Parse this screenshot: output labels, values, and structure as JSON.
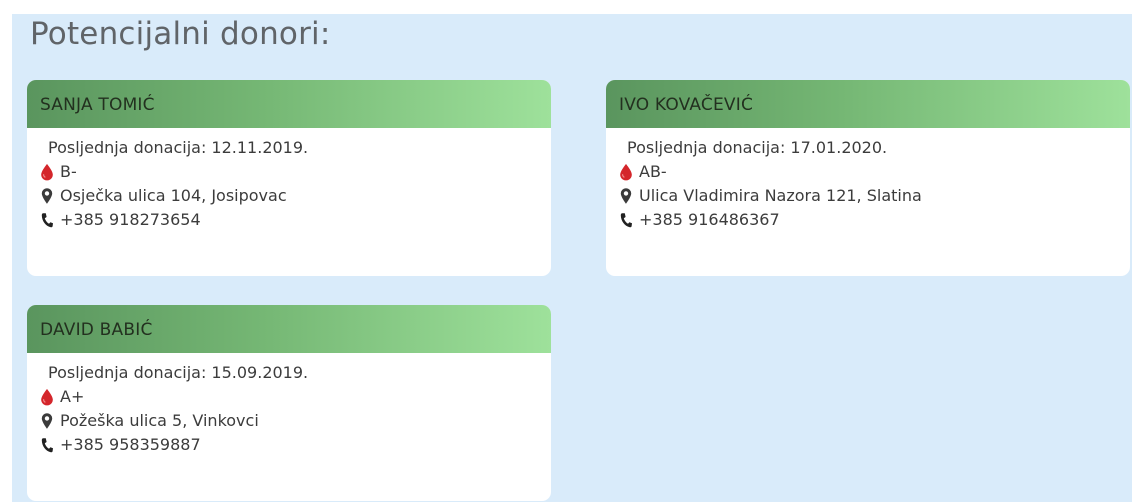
{
  "heading": "Potencijalni donori:",
  "donors": [
    {
      "name": "SANJA TOMIĆ",
      "last_donation": "Posljednja donacija: 12.11.2019.",
      "blood_type": "B-",
      "address": "Osječka ulica 104, Josipovac",
      "phone": "+385 918273654"
    },
    {
      "name": "IVO KOVAČEVIĆ",
      "last_donation": "Posljednja donacija: 17.01.2020.",
      "blood_type": "AB-",
      "address": "Ulica Vladimira Nazora 121, Slatina",
      "phone": "+385 916486367"
    },
    {
      "name": "DAVID BABIĆ",
      "last_donation": "Posljednja donacija: 15.09.2019.",
      "blood_type": "A+",
      "address": "Požeška ulica 5, Vinkovci",
      "phone": "+385 958359887"
    }
  ],
  "icons": {
    "blood": "blood-drop-icon",
    "address": "map-marker-icon",
    "phone": "phone-icon"
  },
  "colors": {
    "background": "#d9ebfa",
    "header_gradient_start": "#5a955e",
    "header_gradient_end": "#9ee19b",
    "blood_drop": "#d4262b"
  }
}
